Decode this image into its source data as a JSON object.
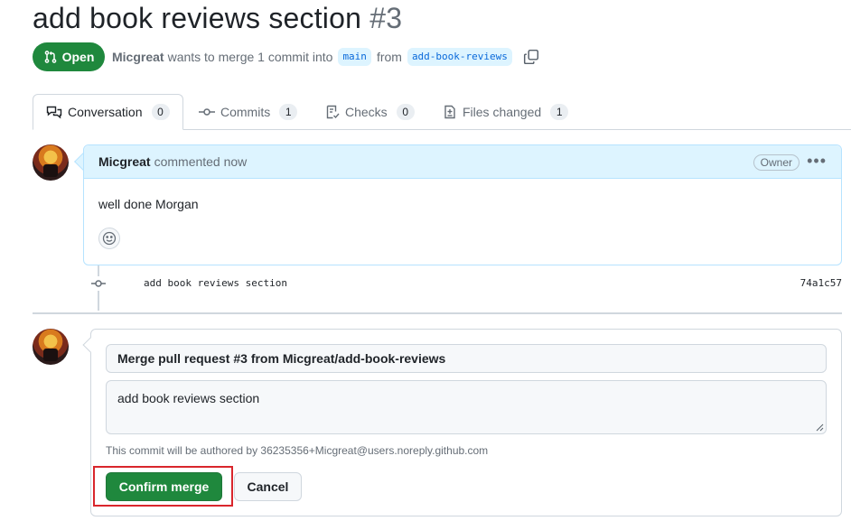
{
  "pr": {
    "title": "add book reviews section",
    "number": "#3",
    "state": "Open",
    "author": "Micgreat",
    "merge_text": "wants to merge 1 commit into",
    "base_branch": "main",
    "from_text": "from",
    "head_branch": "add-book-reviews"
  },
  "tabs": [
    {
      "label": "Conversation",
      "count": "0",
      "icon": "comment-discussion-icon"
    },
    {
      "label": "Commits",
      "count": "1",
      "icon": "git-commit-icon"
    },
    {
      "label": "Checks",
      "count": "0",
      "icon": "checklist-icon"
    },
    {
      "label": "Files changed",
      "count": "1",
      "icon": "file-diff-icon"
    }
  ],
  "comment": {
    "author": "Micgreat",
    "action": "commented now",
    "role_badge": "Owner",
    "body": "well done Morgan"
  },
  "commit": {
    "message": "add book reviews section",
    "sha": "74a1c57"
  },
  "merge": {
    "title_value": "Merge pull request #3 from Micgreat/add-book-reviews",
    "message_value": "add book reviews section",
    "author_note": "This commit will be authored by 36235356+Micgreat@users.noreply.github.com",
    "confirm_label": "Confirm merge",
    "cancel_label": "Cancel"
  },
  "colors": {
    "open_green": "#1f883d",
    "link_blue": "#0969da",
    "comment_header_bg": "#ddf4ff",
    "highlight_red": "#d9262c"
  }
}
